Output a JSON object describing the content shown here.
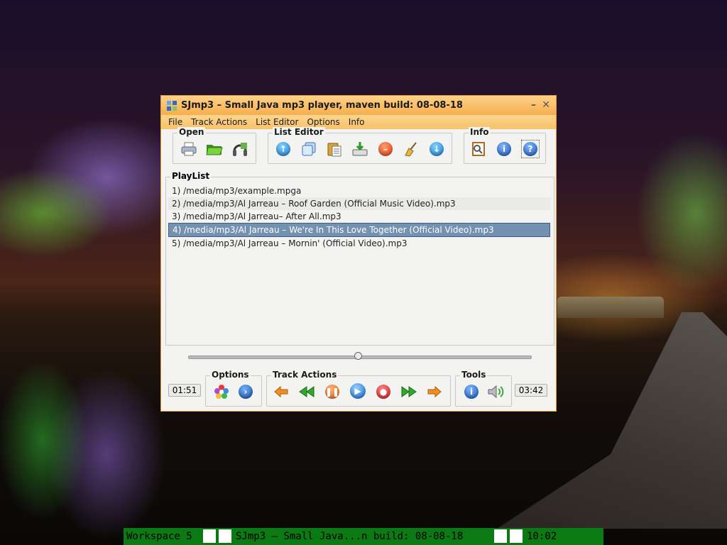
{
  "window": {
    "title": "SJmp3 – Small Java mp3 player, maven build: 08-08-18",
    "min": "–",
    "close": "✕"
  },
  "menu": [
    "File",
    "Track Actions",
    "List Editor",
    "Options",
    "Info"
  ],
  "toolbar": {
    "open_title": "Open",
    "list_editor_title": "List Editor",
    "info_title": "Info"
  },
  "playlist": {
    "title": "PlayList",
    "items": [
      "1) /media/mp3/example.mpga",
      "2) /media/mp3/Al Jarreau – Roof Garden (Official Music Video).mp3",
      "3) /media/mp3/Al Jarreau– After All.mp3",
      "4) /media/mp3/Al Jarreau – We're In This Love Together (Official Video).mp3",
      "5) /media/mp3/Al Jarreau – Mornin' (Official Video).mp3"
    ],
    "selected_index": 3
  },
  "player": {
    "elapsed": "01:51",
    "total": "03:42",
    "position_fraction": 0.5
  },
  "controls": {
    "options_title": "Options",
    "track_actions_title": "Track Actions",
    "tools_title": "Tools"
  },
  "taskbar": {
    "workspace": "Workspace 5",
    "task": "SJmp3 – Small Java...n build: 08-08-18",
    "clock": "10:02"
  },
  "colors": {
    "title_bar": "#f5ae4c",
    "selection": "#7591b2",
    "taskbar": "#0c7a12"
  }
}
